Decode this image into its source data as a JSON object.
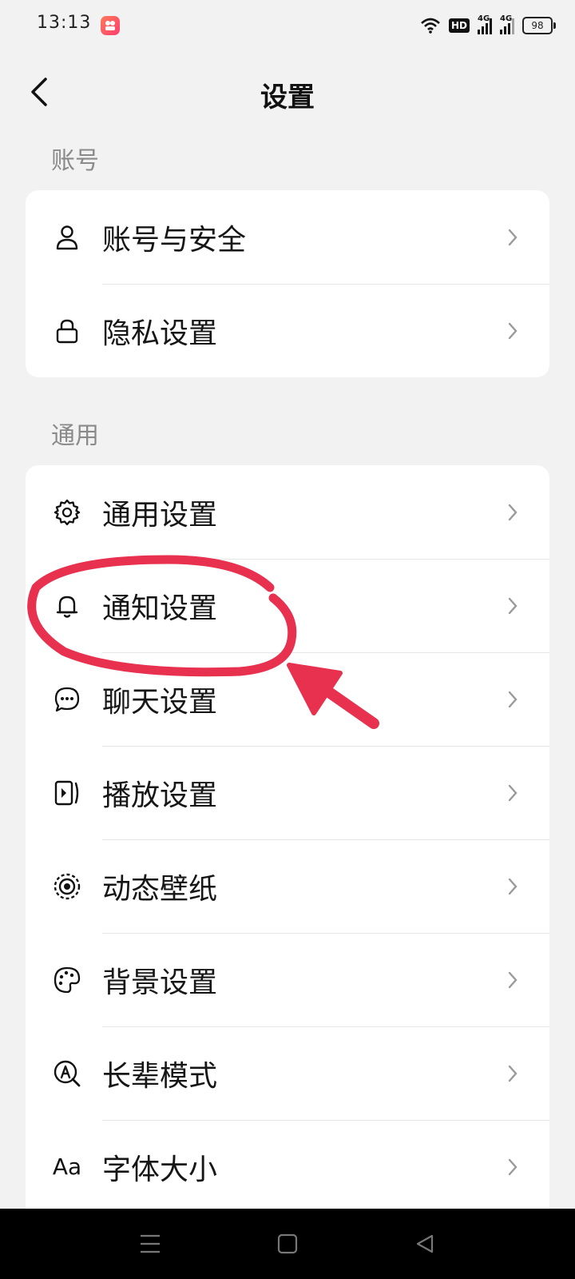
{
  "status": {
    "time": "13:13",
    "hd": "HD",
    "net1": "4G",
    "net2": "4G",
    "battery": "98"
  },
  "header": {
    "title": "设置"
  },
  "sections": {
    "account": {
      "label": "账号",
      "items": [
        {
          "label": "账号与安全",
          "icon": "user-icon"
        },
        {
          "label": "隐私设置",
          "icon": "lock-icon"
        }
      ]
    },
    "general": {
      "label": "通用",
      "items": [
        {
          "label": "通用设置",
          "icon": "gear-icon"
        },
        {
          "label": "通知设置",
          "icon": "bell-icon"
        },
        {
          "label": "聊天设置",
          "icon": "chat-bubble-icon"
        },
        {
          "label": "播放设置",
          "icon": "play-settings-icon"
        },
        {
          "label": "动态壁纸",
          "icon": "live-wallpaper-icon"
        },
        {
          "label": "背景设置",
          "icon": "palette-icon"
        },
        {
          "label": "长辈模式",
          "icon": "elder-mode-icon"
        },
        {
          "label": "字体大小",
          "icon": "font-size-icon",
          "glyph": "Aa"
        }
      ]
    }
  },
  "colors": {
    "annotation": "#e8304f",
    "background": "#f2f2f2",
    "card": "#ffffff"
  }
}
